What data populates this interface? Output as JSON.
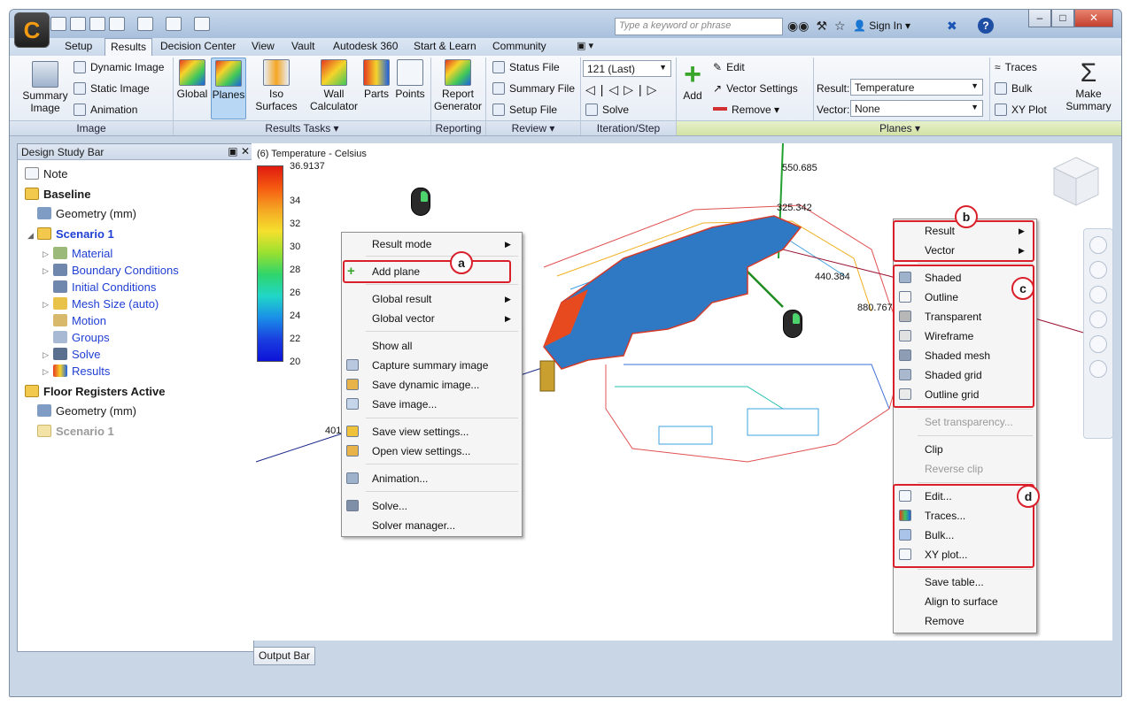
{
  "titlebar": {
    "app_logo": "C",
    "search_placeholder": "Type a keyword or phrase",
    "sign_in": "Sign In",
    "help": "?"
  },
  "menu_tabs": [
    "Setup",
    "Results",
    "Decision Center",
    "View",
    "Vault",
    "Autodesk 360",
    "Start & Learn",
    "Community"
  ],
  "active_tab": "Results",
  "ribbon": {
    "image_group": {
      "label": "Image",
      "summary_image": "Summary Image",
      "dynamic_image": "Dynamic Image",
      "static_image": "Static Image",
      "animation": "Animation"
    },
    "results_tasks": {
      "label": "Results Tasks",
      "global": "Global",
      "planes": "Planes",
      "iso_surfaces": "Iso Surfaces",
      "wall_calculator": "Wall Calculator",
      "parts": "Parts",
      "points": "Points"
    },
    "reporting": {
      "label": "Reporting",
      "report_generator": "Report Generator"
    },
    "review": {
      "label": "Review",
      "status_file": "Status File",
      "summary_file": "Summary File",
      "setup_file": "Setup File"
    },
    "iteration": {
      "label": "Iteration/Step",
      "step_value": "121 (Last)",
      "solve": "Solve"
    },
    "planes_group": {
      "label": "Planes",
      "add": "Add",
      "edit": "Edit",
      "vector_settings": "Vector Settings",
      "remove": "Remove",
      "result_label": "Result:",
      "result_value": "Temperature",
      "vector_label": "Vector:",
      "vector_value": "None",
      "traces": "Traces",
      "bulk": "Bulk",
      "xy_plot": "XY Plot",
      "make_summary": "Make Summary"
    }
  },
  "design_study_bar": {
    "title": "Design Study Bar",
    "items": [
      {
        "label": "Note"
      },
      {
        "label": "Baseline"
      },
      {
        "label": "Geometry (mm)"
      },
      {
        "label": "Scenario 1"
      },
      {
        "label": "Material"
      },
      {
        "label": "Boundary Conditions"
      },
      {
        "label": "Initial Conditions"
      },
      {
        "label": "Mesh Size (auto)"
      },
      {
        "label": "Motion"
      },
      {
        "label": "Groups"
      },
      {
        "label": "Solve"
      },
      {
        "label": "Results"
      },
      {
        "label": "Floor Registers Active"
      },
      {
        "label": "Geometry (mm)"
      },
      {
        "label": "Scenario 1"
      }
    ]
  },
  "legend": {
    "title": "(6) Temperature - Celsius",
    "ticks": [
      "36.9137",
      "34",
      "32",
      "30",
      "28",
      "26",
      "24",
      "22",
      "20"
    ]
  },
  "viewport_labels": {
    "a1": "550.685",
    "a2": "325.342",
    "a3": "440.384",
    "a4": "880.767",
    "a5": "401"
  },
  "context_menu_left": {
    "items": [
      "Result mode",
      "Add plane",
      "Global result",
      "Global vector",
      "Show all",
      "Capture summary image",
      "Save dynamic image...",
      "Save image...",
      "Save view settings...",
      "Open view settings...",
      "Animation...",
      "Solve...",
      "Solver manager..."
    ]
  },
  "context_menu_right": {
    "items": [
      "Result",
      "Vector",
      "Shaded",
      "Outline",
      "Transparent",
      "Wireframe",
      "Shaded mesh",
      "Shaded grid",
      "Outline grid",
      "Set transparency...",
      "Clip",
      "Reverse clip",
      "Edit...",
      "Traces...",
      "Bulk...",
      "XY plot...",
      "Save table...",
      "Align to surface",
      "Remove"
    ]
  },
  "callouts": [
    "a",
    "b",
    "c",
    "d"
  ],
  "output_bar": "Output Bar",
  "colors": {
    "callout_red": "#d9202a",
    "link_blue": "#1f3fd3",
    "ribbon_active": "#b7d7f5"
  }
}
